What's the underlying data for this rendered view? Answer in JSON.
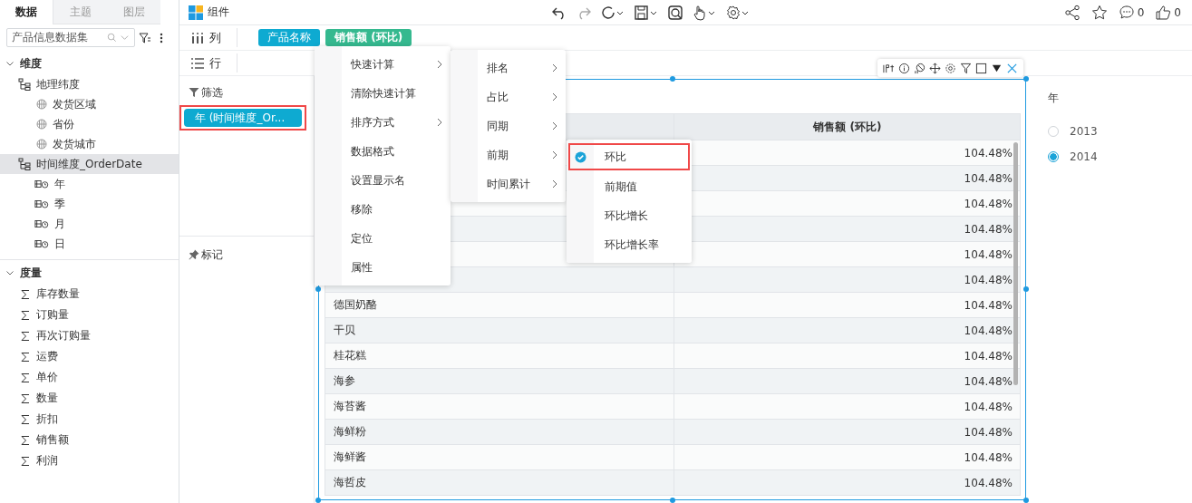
{
  "header": {
    "title": "组件",
    "comment_count": "0",
    "like_count": "0"
  },
  "sidebar": {
    "tabs": [
      {
        "label": "数据",
        "selected": true
      },
      {
        "label": "主题",
        "selected": false
      },
      {
        "label": "图层",
        "selected": false
      }
    ],
    "dataset": "产品信息数据集",
    "dimensions": {
      "label": "维度",
      "expanded": true,
      "children": [
        {
          "label": "地理纬度",
          "kind": "hierarchy",
          "selected": false,
          "children": [
            {
              "label": "发货区域",
              "kind": "geo"
            },
            {
              "label": "省份",
              "kind": "geo"
            },
            {
              "label": "发货城市",
              "kind": "geo"
            }
          ]
        },
        {
          "label": "时间维度_OrderDate",
          "kind": "hierarchy",
          "selected": true,
          "children": [
            {
              "label": "年",
              "kind": "date"
            },
            {
              "label": "季",
              "kind": "date"
            },
            {
              "label": "月",
              "kind": "date"
            },
            {
              "label": "日",
              "kind": "date"
            }
          ]
        }
      ]
    },
    "measures": {
      "label": "度量",
      "expanded": true,
      "items": [
        "库存数量",
        "订购量",
        "再次订购量",
        "运费",
        "单价",
        "数量",
        "折扣",
        "销售额",
        "利润"
      ]
    }
  },
  "shelves": [
    {
      "label": "列",
      "kind": "columns",
      "pills": [
        {
          "label": "产品名称",
          "kind": "dimension"
        },
        {
          "label": "销售额 (环比)",
          "kind": "measure"
        }
      ]
    },
    {
      "label": "行",
      "kind": "rows"
    }
  ],
  "filters": {
    "label": "筛选",
    "pills": [
      {
        "label": "年 (时间维度_Or...",
        "highlighted": true
      }
    ]
  },
  "marks": {
    "label": "标记"
  },
  "context_menu": [
    {
      "label": "快速计算",
      "submenu": true
    },
    {
      "label": "清除快速计算",
      "submenu": false
    },
    {
      "label": "排序方式",
      "submenu": true
    },
    {
      "label": "数据格式",
      "submenu": false
    },
    {
      "label": "设置显示名",
      "submenu": false
    },
    {
      "label": "移除",
      "submenu": false
    },
    {
      "label": "定位",
      "submenu": false
    },
    {
      "label": "属性",
      "submenu": false
    }
  ],
  "quick_calc_menu": [
    {
      "label": "排名",
      "submenu": true
    },
    {
      "label": "占比",
      "submenu": true
    },
    {
      "label": "同期",
      "submenu": true
    },
    {
      "label": "前期",
      "submenu": true
    },
    {
      "label": "时间累计",
      "submenu": true
    }
  ],
  "previous_period_menu": [
    {
      "label": "环比",
      "checked": true,
      "highlighted": true
    },
    {
      "label": "前期值",
      "checked": false,
      "highlighted": false
    },
    {
      "label": "环比增长",
      "checked": false,
      "highlighted": false
    },
    {
      "label": "环比增长率",
      "checked": false,
      "highlighted": false
    }
  ],
  "table": {
    "value_column": "销售额 (环比)",
    "rows": [
      {
        "value": "104.48%"
      },
      {
        "value": "104.48%"
      },
      {
        "value": "104.48%"
      },
      {
        "value": "104.48%"
      },
      {
        "value": "104.48%"
      },
      {
        "value": "104.48%"
      },
      {
        "product": "德国奶酪",
        "value": "104.48%"
      },
      {
        "product": "干贝",
        "value": "104.48%"
      },
      {
        "product": "桂花糕",
        "value": "104.48%"
      },
      {
        "product": "海参",
        "value": "104.48%"
      },
      {
        "product": "海苔酱",
        "value": "104.48%"
      },
      {
        "product": "海鲜粉",
        "value": "104.48%"
      },
      {
        "product": "海鲜酱",
        "value": "104.48%"
      },
      {
        "product": "海哲皮",
        "value": "104.48%"
      }
    ]
  },
  "year_filter": {
    "title": "年",
    "options": [
      {
        "label": "2013",
        "selected": false
      },
      {
        "label": "2014",
        "selected": true
      }
    ]
  }
}
